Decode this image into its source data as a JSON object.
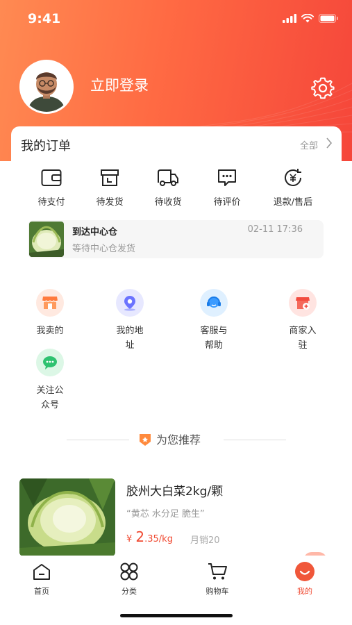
{
  "status_bar": {
    "time": "9:41"
  },
  "profile": {
    "login_text": "立即登录"
  },
  "orders": {
    "title": "我的订单",
    "all_label": "全部",
    "statuses": [
      {
        "label": "待支付",
        "icon": "wallet-icon"
      },
      {
        "label": "待发货",
        "icon": "box-icon"
      },
      {
        "label": "待收货",
        "icon": "truck-icon"
      },
      {
        "label": "待评价",
        "icon": "comment-icon"
      },
      {
        "label": "退款/售后",
        "icon": "refund-icon"
      }
    ],
    "logistics": {
      "title": "到达中心仓",
      "time": "02-11 17:36",
      "subtitle": "等待中心仓发货"
    }
  },
  "services": [
    {
      "label": "我卖的",
      "icon": "shop-icon",
      "color": "#ff7a3d"
    },
    {
      "label": "我的地址",
      "icon": "location-icon",
      "color": "#6b73ff"
    },
    {
      "label": "客服与帮助",
      "icon": "headset-icon",
      "color": "#3b9bff"
    },
    {
      "label": "商家入驻",
      "icon": "merchant-icon",
      "color": "#f24b3f"
    },
    {
      "label": "关注公众号",
      "icon": "wechat-icon",
      "color": "#2ec270"
    }
  ],
  "recommend": {
    "title": "为您推荐"
  },
  "product": {
    "name": "胶州大白菜2kg/颗",
    "desc": "“黄芯 水分足 脆生”",
    "currency": "¥",
    "price_int": "2",
    "price_dec": ".35/kg",
    "sales": "月销20"
  },
  "tabbar": [
    {
      "label": "首页",
      "icon": "home-icon",
      "active": false
    },
    {
      "label": "分类",
      "icon": "category-icon",
      "active": false
    },
    {
      "label": "购物车",
      "icon": "cart-icon",
      "active": false
    },
    {
      "label": "我的",
      "icon": "profile-icon",
      "active": true
    }
  ],
  "colors": {
    "accent": "#f04a32",
    "header_start": "#ff8a52",
    "header_end": "#f5463a"
  }
}
